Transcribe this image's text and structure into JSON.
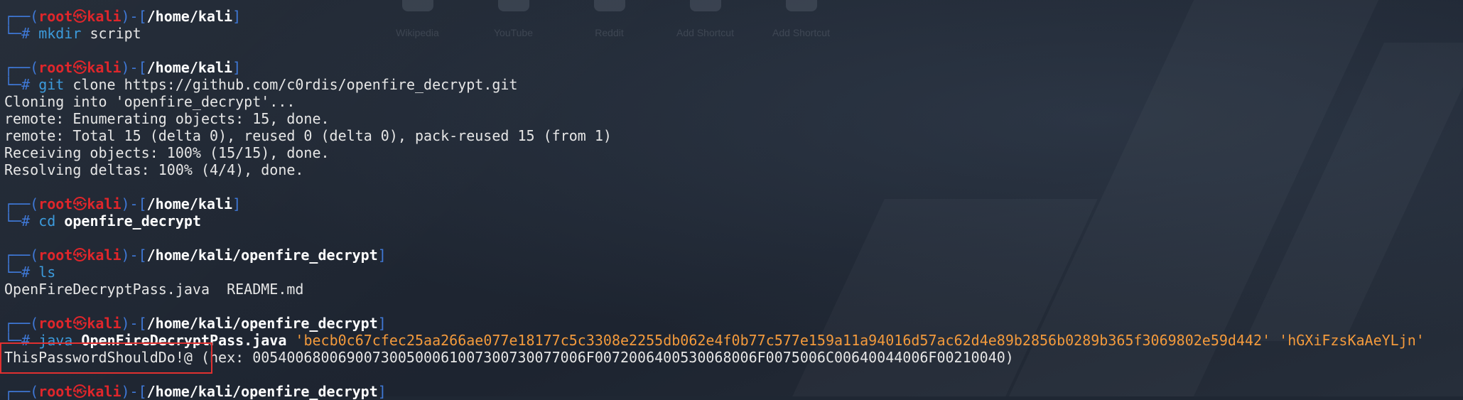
{
  "background_shortcuts": [
    {
      "label": "Wikipedia",
      "icon": "wikipedia-icon"
    },
    {
      "label": "YouTube",
      "icon": "youtube-icon"
    },
    {
      "label": "Reddit",
      "icon": "reddit-icon"
    },
    {
      "label": "Add Shortcut",
      "icon": "add-icon"
    },
    {
      "label": "Add Shortcut",
      "icon": "add-icon"
    }
  ],
  "prompt": {
    "open_box": "┌──(",
    "user": "root",
    "skull": "㉿",
    "host": "kali",
    "mid_box": ")-[",
    "close_bracket": "]",
    "cmd_box": "└─",
    "hash": "# "
  },
  "blocks": [
    {
      "path": "/home/kali",
      "cmd": "mkdir",
      "args": " script",
      "argsBold": "",
      "strings": "",
      "output": []
    },
    {
      "path": "/home/kali",
      "cmd": "git",
      "args": " clone https://github.com/c0rdis/openfire_decrypt.git",
      "argsBold": "",
      "strings": "",
      "output": [
        "Cloning into 'openfire_decrypt'...",
        "remote: Enumerating objects: 15, done.",
        "remote: Total 15 (delta 0), reused 0 (delta 0), pack-reused 15 (from 1)",
        "Receiving objects: 100% (15/15), done.",
        "Resolving deltas: 100% (4/4), done."
      ]
    },
    {
      "path": "/home/kali",
      "cmd": "cd",
      "args": "",
      "argsBold": " openfire_decrypt",
      "strings": "",
      "output": []
    },
    {
      "path": "/home/kali/openfire_decrypt",
      "cmd": "ls",
      "args": "",
      "argsBold": "",
      "strings": "",
      "output": [
        "OpenFireDecryptPass.java  README.md"
      ]
    },
    {
      "path": "/home/kali/openfire_decrypt",
      "cmd": "java",
      "args": "",
      "argsBold": " OpenFireDecryptPass.java",
      "strings": " 'becb0c67cfec25aa266ae077e18177c5c3308e2255db062e4f0b77c577e159a11a94016d57ac62d4e89b2856b0289b365f3069802e59d442' 'hGXiFzsKaAeYLjn'",
      "output": [
        "ThisPasswordShouldDo!@ (hex: 005400680069007300500061007300730077006F0072006400530068006F0075006C00640044006F00210040)"
      ]
    },
    {
      "path": "/home/kali/openfire_decrypt",
      "cmd": "",
      "args": "",
      "argsBold": "",
      "strings": "",
      "output": []
    }
  ]
}
